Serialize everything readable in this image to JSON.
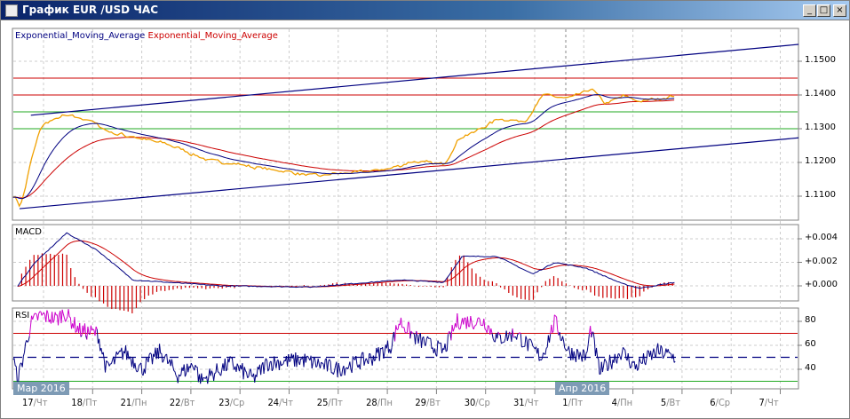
{
  "window": {
    "title": "График EUR /USD  ЧАС",
    "minimize": "_",
    "maximize": "□",
    "close": "×"
  },
  "legend": {
    "ema1": "Exponential_Moving_Average",
    "ema2": "Exponential_Moving_Average"
  },
  "panels": {
    "macd": "MACD",
    "rsi": "RSI"
  },
  "colors": {
    "price": "#f0a000",
    "ema_fast": "#000080",
    "ema_slow": "#cc0000",
    "trend": "#000080",
    "resistance": "#cc0000",
    "support": "#22aa22",
    "rsi_overbought": "#cc00cc",
    "macd_hist": "#cc0000"
  },
  "axis": {
    "price_ticks": [
      "1.1500",
      "1.1400",
      "1.1300",
      "1.1200",
      "1.1100"
    ],
    "macd_ticks": [
      "+0.004",
      "+0.002",
      "+0.000"
    ],
    "rsi_ticks": [
      "80",
      "60",
      "40"
    ],
    "months": [
      "Мар 2016",
      "Апр 2016"
    ],
    "days": [
      {
        "d": "17",
        "w": "/Чт"
      },
      {
        "d": "18",
        "w": "/Пт"
      },
      {
        "d": "21",
        "w": "/Пн"
      },
      {
        "d": "22",
        "w": "/Вт"
      },
      {
        "d": "23",
        "w": "/Ср"
      },
      {
        "d": "24",
        "w": "/Чт"
      },
      {
        "d": "25",
        "w": "/Пт"
      },
      {
        "d": "28",
        "w": "/Пн"
      },
      {
        "d": "29",
        "w": "/Вт"
      },
      {
        "d": "30",
        "w": "/Ср"
      },
      {
        "d": "31",
        "w": "/Чт"
      },
      {
        "d": "1",
        "w": "/Пт"
      },
      {
        "d": "4",
        "w": "/Пн"
      },
      {
        "d": "5",
        "w": "/Вт"
      },
      {
        "d": "6",
        "w": "/Ср"
      },
      {
        "d": "7",
        "w": "/Чт"
      }
    ]
  },
  "chart_data": {
    "type": "line",
    "title": "EUR/USD H1",
    "x_unit": "trading day index (0 = 17 Mar)",
    "price": [
      [
        -0.22,
        1.1103
      ],
      [
        -0.09,
        1.1065
      ],
      [
        0.14,
        1.122
      ],
      [
        0.33,
        1.131
      ],
      [
        0.78,
        1.134
      ],
      [
        1.32,
        1.1325
      ],
      [
        1.68,
        1.129
      ],
      [
        2.77,
        1.126
      ],
      [
        3.67,
        1.121
      ],
      [
        4.94,
        1.118
      ],
      [
        5.84,
        1.116
      ],
      [
        7.11,
        1.1175
      ],
      [
        7.65,
        1.119
      ],
      [
        7.83,
        1.1205
      ],
      [
        8.55,
        1.1195
      ],
      [
        8.82,
        1.127
      ],
      [
        9.28,
        1.13
      ],
      [
        9.64,
        1.133
      ],
      [
        10.18,
        1.132
      ],
      [
        10.54,
        1.14
      ],
      [
        11.08,
        1.139
      ],
      [
        11.54,
        1.142
      ],
      [
        11.81,
        1.137
      ],
      [
        12.17,
        1.14
      ],
      [
        12.53,
        1.138
      ],
      [
        13.26,
        1.1398
      ]
    ],
    "price_ylim": [
      1.105,
      1.157
    ],
    "trendlines": [
      {
        "from": [
          0.14,
          1.134
        ],
        "to": [
          15.77,
          1.155
        ]
      },
      {
        "from": [
          -0.09,
          1.1063
        ],
        "to": [
          15.77,
          1.1273
        ]
      }
    ],
    "horizontal_levels": {
      "resistance": [
        1.145,
        1.14
      ],
      "support": [
        1.135,
        1.13
      ]
    },
    "macd": [
      [
        -0.13,
        0.0
      ],
      [
        0.23,
        0.002
      ],
      [
        0.87,
        0.0045
      ],
      [
        1.5,
        0.003
      ],
      [
        2.22,
        0.0005
      ],
      [
        4.03,
        0.0
      ],
      [
        5.84,
        -0.0001
      ],
      [
        7.65,
        0.0005
      ],
      [
        8.55,
        0.0003
      ],
      [
        8.92,
        0.0025
      ],
      [
        9.64,
        0.0025
      ],
      [
        10.36,
        0.001
      ],
      [
        10.81,
        0.002
      ],
      [
        11.45,
        0.0015
      ],
      [
        12.17,
        0.0002
      ],
      [
        12.53,
        -0.0002
      ],
      [
        13.26,
        0.0003
      ]
    ],
    "macd_ylim": [
      -0.0013,
      0.0052
    ],
    "rsi": [
      [
        -0.22,
        50
      ],
      [
        -0.13,
        30
      ],
      [
        0.14,
        78
      ],
      [
        0.33,
        85
      ],
      [
        0.69,
        82
      ],
      [
        0.81,
        88
      ],
      [
        1.14,
        72
      ],
      [
        1.5,
        70
      ],
      [
        1.68,
        40
      ],
      [
        2.04,
        55
      ],
      [
        2.4,
        40
      ],
      [
        2.77,
        55
      ],
      [
        3.13,
        35
      ],
      [
        3.49,
        45
      ],
      [
        3.58,
        30
      ],
      [
        4.21,
        45
      ],
      [
        4.67,
        32
      ],
      [
        4.94,
        45
      ],
      [
        5.66,
        48
      ],
      [
        6.39,
        40
      ],
      [
        7.11,
        50
      ],
      [
        7.47,
        60
      ],
      [
        7.65,
        80
      ],
      [
        8.01,
        65
      ],
      [
        8.55,
        55
      ],
      [
        8.82,
        80
      ],
      [
        9.37,
        80
      ],
      [
        9.64,
        65
      ],
      [
        10,
        70
      ],
      [
        10.54,
        50
      ],
      [
        10.81,
        80
      ],
      [
        11.08,
        55
      ],
      [
        11.45,
        50
      ],
      [
        11.54,
        75
      ],
      [
        11.72,
        38
      ],
      [
        12.17,
        55
      ],
      [
        12.44,
        42
      ],
      [
        12.9,
        55
      ],
      [
        13.26,
        50
      ]
    ],
    "rsi_levels": [
      70,
      50,
      30
    ],
    "rsi_ylim": [
      28,
      92
    ]
  }
}
